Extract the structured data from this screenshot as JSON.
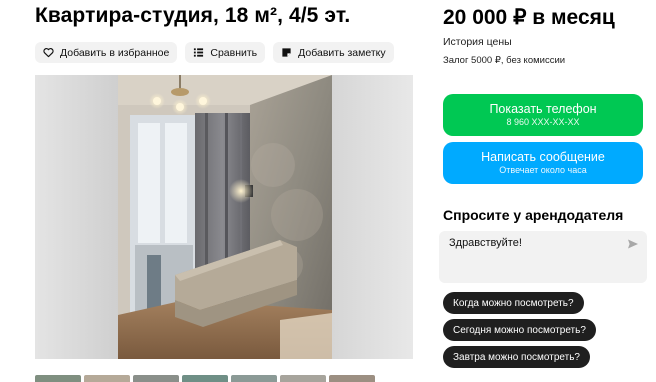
{
  "listing": {
    "title": "Квартира-студия, 18 м², 4/5 эт.",
    "actions": {
      "favorite": "Добавить в избранное",
      "compare": "Сравнить",
      "note": "Добавить заметку"
    }
  },
  "pricing": {
    "price": "20 000 ₽ в месяц",
    "history": "История цены",
    "deposit": "Залог 5000 ₽, без комиссии"
  },
  "contact": {
    "phone_label": "Показать телефон",
    "phone_masked": "8 960 XXX-XX-XX",
    "message_label": "Написать сообщение",
    "message_sub": "Отвечает около часа"
  },
  "ask": {
    "title": "Спросите у арендодателя",
    "input_value": "Здравствуйте!",
    "suggestions": [
      "Когда можно посмотреть?",
      "Сегодня можно посмотреть?",
      "Завтра можно посмотреть?"
    ]
  },
  "icons": {
    "favorite": "heart-icon",
    "compare": "compare-icon",
    "note": "note-icon",
    "send": "send-icon"
  },
  "colors": {
    "phone_button": "#00c853",
    "message_button": "#00aaff",
    "chip_bg": "#1f1f1f"
  }
}
